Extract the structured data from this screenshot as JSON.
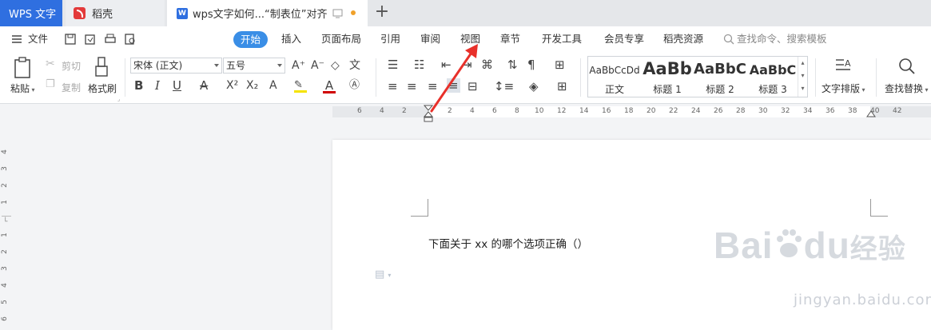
{
  "tabs": {
    "app": "WPS 文字",
    "daoke": "稻壳",
    "document": "wps文字如何...“制表位”对齐"
  },
  "menu": {
    "file": "文件",
    "items": [
      "开始",
      "插入",
      "页面布局",
      "引用",
      "审阅",
      "视图",
      "章节",
      "开发工具",
      "会员专享",
      "稻壳资源"
    ],
    "search": "查找命令、搜索模板"
  },
  "ribbon": {
    "paste": "粘贴",
    "cut": "剪切",
    "copy": "复制",
    "format_painter": "格式刷",
    "font_name": "宋体 (正文)",
    "font_size": "五号",
    "styles": [
      {
        "sample": "AaBbCcDd",
        "name": "正文"
      },
      {
        "sample": "AaBb",
        "name": "标题 1"
      },
      {
        "sample": "AaBbC",
        "name": "标题 2"
      },
      {
        "sample": "AaBbC",
        "name": "标题 3"
      }
    ],
    "text_layout": "文字排版",
    "find_replace": "查找替换"
  },
  "ruler": {
    "top": [
      "6",
      "4",
      "2",
      "2",
      "4",
      "6",
      "8",
      "10",
      "12",
      "14",
      "16",
      "18",
      "20",
      "22",
      "24",
      "26",
      "28",
      "30",
      "32",
      "34",
      "36",
      "38",
      "40",
      "42"
    ],
    "side": [
      "4",
      "3",
      "2",
      "1",
      "1",
      "2",
      "3",
      "4",
      "5",
      "6"
    ]
  },
  "document": {
    "line1": "下面关于 xx 的哪个选项正确（）"
  },
  "watermark": {
    "main": "Bai",
    "middle": "du",
    "cn": "经验",
    "sub": "jingyan.baidu.com"
  },
  "colors": {
    "accent": "#3a8ee6",
    "wps_blue": "#2f6fe0",
    "annotation_arrow": "#e8302a"
  }
}
